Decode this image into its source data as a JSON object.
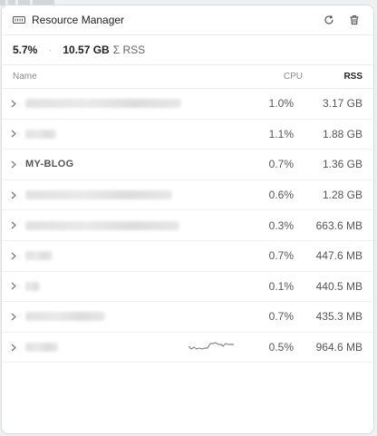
{
  "header": {
    "title": "Resource Manager",
    "title_icon": "memory-chip-icon",
    "refresh_icon": "refresh-icon",
    "delete_icon": "trash-icon"
  },
  "summary": {
    "cpu_total": "5.7%",
    "separator": "·",
    "rss_total": "10.57 GB",
    "rss_suffix": "Σ RSS"
  },
  "columns": {
    "name": "Name",
    "cpu": "CPU",
    "rss": "RSS"
  },
  "rows": [
    {
      "name": "",
      "cpu": "1.0%",
      "rss": "3.17 GB"
    },
    {
      "name": "",
      "cpu": "1.1%",
      "rss": "1.88 GB"
    },
    {
      "name": "MY-BLOG",
      "cpu": "0.7%",
      "rss": "1.36 GB"
    },
    {
      "name": "",
      "cpu": "0.6%",
      "rss": "1.28 GB"
    },
    {
      "name": "",
      "cpu": "0.3%",
      "rss": "663.6 MB"
    },
    {
      "name": "",
      "cpu": "0.7%",
      "rss": "447.6 MB"
    },
    {
      "name": "",
      "cpu": "0.1%",
      "rss": "440.5 MB"
    },
    {
      "name": "",
      "cpu": "0.7%",
      "rss": "435.3 MB"
    },
    {
      "name": "",
      "cpu": "0.5%",
      "rss": "964.6 MB"
    }
  ],
  "colors": {
    "accent_text": "#222222",
    "muted_text": "#8a8a8a",
    "border": "#ececec"
  }
}
